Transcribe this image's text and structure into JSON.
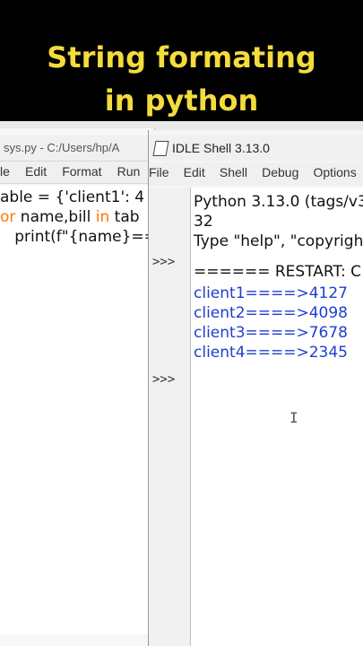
{
  "banner": {
    "line1": "String formating",
    "line2": "in python"
  },
  "editor": {
    "title": "sys.py - C:/Users/hp/A",
    "menu": [
      "le",
      "Edit",
      "Format",
      "Run"
    ],
    "code": {
      "line1": "able = {'client1': 4",
      "line2_kw": "or",
      "line2_a": " name,bill ",
      "line2_kw2": "in",
      "line2_b": " tab",
      "line3": "   print(f\"{name}==="
    }
  },
  "shell": {
    "title": "IDLE Shell 3.13.0",
    "menu": [
      "File",
      "Edit",
      "Shell",
      "Debug",
      "Options"
    ],
    "prompt": ">>>",
    "lines": {
      "python_version": "Python 3.13.0 (tags/v3",
      "arch": "32",
      "type_help": "Type \"help\", \"copyright",
      "restart": "====== RESTART: C"
    },
    "outputs": [
      "client1====>4127",
      "client2====>4098",
      "client3====>7678",
      "client4====>2345"
    ]
  },
  "colors": {
    "banner_text": "#f3dc3c",
    "keyword": "#ff7700",
    "output_blue": "#1f3fcf"
  }
}
